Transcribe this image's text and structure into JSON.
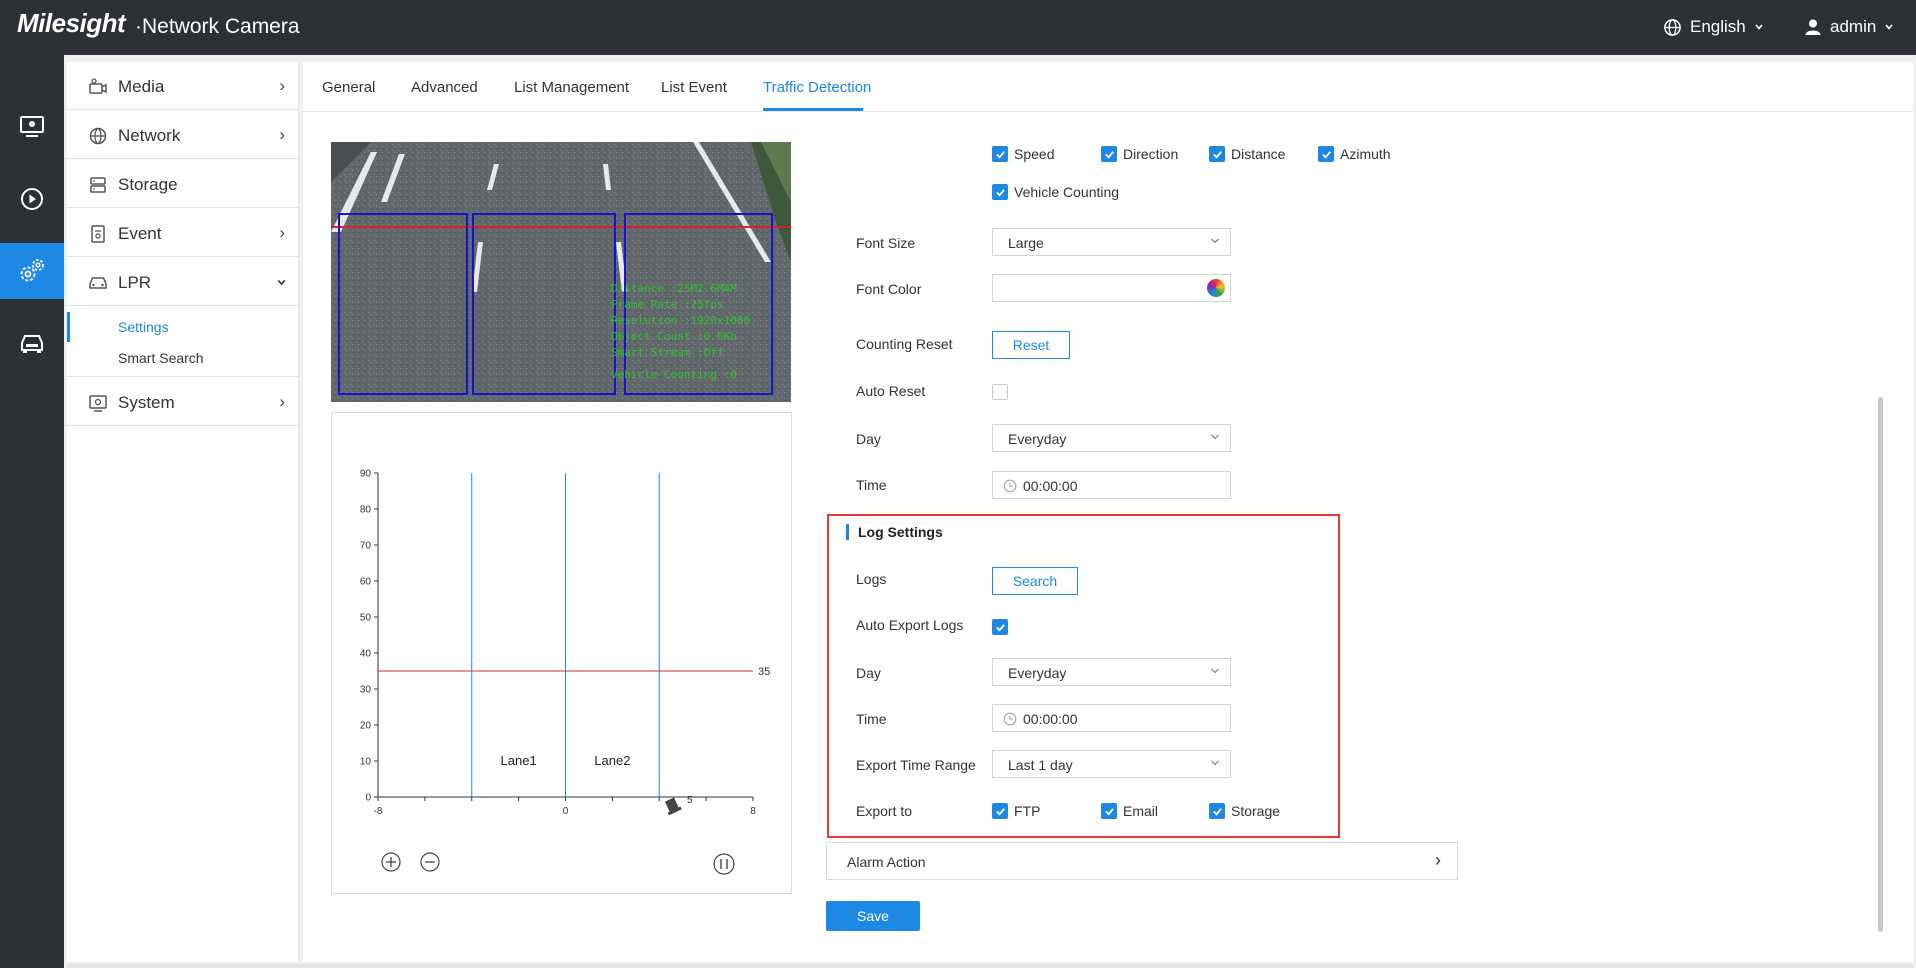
{
  "header": {
    "brand": "Milesight",
    "product": "·Network Camera",
    "language": "English",
    "user": "admin"
  },
  "sidebar": {
    "items": [
      {
        "label": "Media",
        "icon": "camera-icon"
      },
      {
        "label": "Network",
        "icon": "globe-icon"
      },
      {
        "label": "Storage",
        "icon": "storage-icon"
      },
      {
        "label": "Event",
        "icon": "event-icon"
      },
      {
        "label": "LPR",
        "icon": "car-icon"
      },
      {
        "label": "System",
        "icon": "system-icon"
      }
    ],
    "lpr_sub": [
      "Settings",
      "Smart Search"
    ]
  },
  "tabs": [
    "General",
    "Advanced",
    "List Management",
    "List Event",
    "Traffic Detection"
  ],
  "overlay_options": {
    "items": [
      "Speed",
      "Direction",
      "Distance",
      "Azimuth",
      "Vehicle Counting"
    ]
  },
  "form": {
    "font_size_label": "Font Size",
    "font_size_value": "Large",
    "font_color_label": "Font Color",
    "counting_reset_label": "Counting Reset",
    "reset_button": "Reset",
    "auto_reset_label": "Auto Reset",
    "day_label": "Day",
    "day_value": "Everyday",
    "time_label": "Time",
    "time_value": "00:00:00"
  },
  "log_settings": {
    "title": "Log Settings",
    "logs_label": "Logs",
    "search_button": "Search",
    "auto_export_label": "Auto Export Logs",
    "day_label": "Day",
    "day_value": "Everyday",
    "time_label": "Time",
    "time_value": "00:00:00",
    "range_label": "Export Time Range",
    "range_value": "Last 1 day",
    "export_label": "Export to",
    "export_targets": [
      "FTP",
      "Email",
      "Storage"
    ]
  },
  "alarm_action": "Alarm Action",
  "save_button": "Save",
  "chart_data": {
    "type": "line",
    "x_ticks": [
      "-8",
      "0",
      "8"
    ],
    "y_ticks": [
      "0",
      "10",
      "20",
      "30",
      "40",
      "50",
      "60",
      "70",
      "80",
      "90"
    ],
    "xlim": [
      -8,
      8
    ],
    "ylim": [
      0,
      90
    ],
    "lane_lines_x": [
      -4,
      0,
      4
    ],
    "threshold_y": 35,
    "threshold_label": "35",
    "lanes": [
      {
        "name": "Lane1",
        "x": -2,
        "y": 10
      },
      {
        "name": "Lane2",
        "x": 2,
        "y": 10
      }
    ],
    "radar_label": "5"
  },
  "colors": {
    "accent": "#1e88e5",
    "highlight": "#e53935",
    "topbar": "#2d3035"
  }
}
